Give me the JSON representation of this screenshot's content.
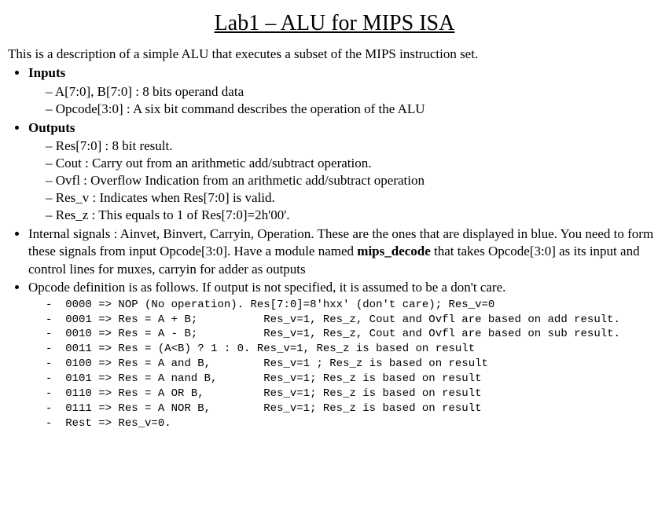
{
  "title": "Lab1 – ALU for MIPS ISA",
  "intro": "This is a description of a simple ALU that executes a subset of the MIPS instruction set.",
  "inputs_header": "Inputs",
  "inputs": [
    "A[7:0], B[7:0] : 8 bits operand data",
    "Opcode[3:0] : A six bit command describes the operation of the ALU"
  ],
  "outputs_header": "Outputs",
  "outputs": [
    "Res[7:0] : 8 bit result.",
    "Cout :   Carry out from an arithmetic add/subtract operation.",
    "Ovfl : Overflow Indication from an arithmetic add/subtract operation",
    "Res_v : Indicates when Res[7:0] is valid.",
    "Res_z : This equals to 1 of Res[7:0]=2h'00'."
  ],
  "internal_pre": "Internal signals : Ainvet, Binvert, Carryin, Operation.  These are the ones that are displayed in blue. You need to form these signals from  input Opcode[3:0]. Have a module named ",
  "internal_bold": "mips_decode",
  "internal_post": " that takes Opcode[3:0] as its input and control lines for muxes, carryin for adder as outputs",
  "opcode_header": "Opcode definition is as follows. If output is not specified, it is assumed to be a don't care.",
  "opcodes": [
    "0000 => NOP (No operation). Res[7:0]=8'hxx' (don't care); Res_v=0",
    "0001 => Res = A + B;          Res_v=1, Res_z, Cout and Ovfl are based on add result.",
    "0010 => Res = A - B;          Res_v=1, Res_z, Cout and Ovfl are based on sub result.",
    "0011 => Res = (A<B) ? 1 : 0. Res_v=1, Res_z is based on result",
    "0100 => Res = A and B,        Res_v=1 ; Res_z is based on result",
    "0101 => Res = A nand B,       Res_v=1; Res_z is based on result",
    "0110 => Res = A OR B,         Res_v=1; Res_z is based on result",
    "0111 => Res = A NOR B,        Res_v=1; Res_z is based on result",
    "Rest => Res_v=0."
  ]
}
